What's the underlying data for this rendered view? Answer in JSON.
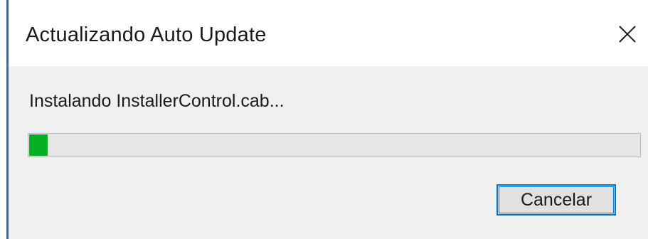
{
  "window": {
    "title": "Actualizando Auto Update",
    "close_icon": "close-icon",
    "accent_color": "#0078d7"
  },
  "content": {
    "status_text": "Instalando InstallerControl.cab...",
    "progress": {
      "percent": 3,
      "fill_color": "#06b025"
    },
    "cancel_label": "Cancelar"
  }
}
